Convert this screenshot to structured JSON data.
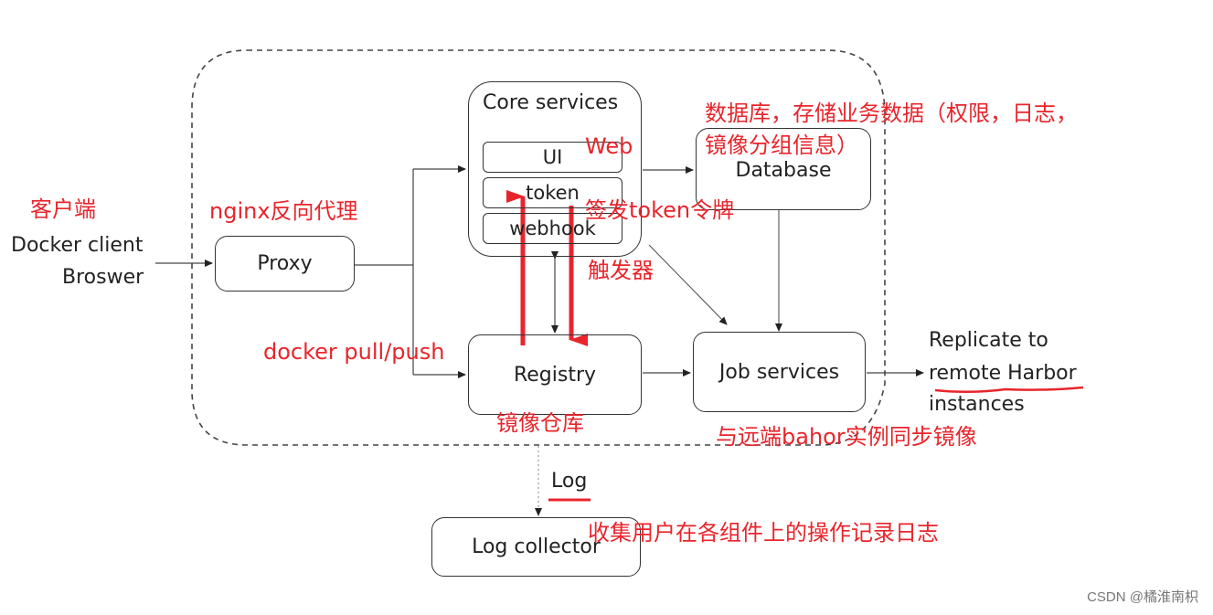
{
  "nodes": {
    "proxy": "Proxy",
    "core_services": "Core services",
    "ui": "UI",
    "token": "token",
    "webhook": "webhook",
    "database": "Database",
    "registry": "Registry",
    "job_services": "Job services",
    "log_collector": "Log collector"
  },
  "labels": {
    "client_line1": "Docker client",
    "client_line2": "Broswer",
    "replicate_line1": "Replicate to",
    "replicate_line2": "remote Harbor",
    "replicate_line3": "instances",
    "log": "Log"
  },
  "annotations": {
    "client": "客户端",
    "proxy": "nginx反向代理",
    "web": "Web",
    "token": "签发token令牌",
    "webhook": "触发器",
    "database_line1": "数据库，存储业务数据（权限，日志，",
    "database_line2": "镜像分组信息）",
    "docker_pull_push": "docker pull/push",
    "registry": "镜像仓库",
    "job_services": "与远端bahor实例同步镜像",
    "log_collector": "收集用户在各组件上的操作记录日志"
  },
  "colors": {
    "annotation": "#e8252c",
    "line": "#333333"
  },
  "watermark": "CSDN @橘淮南枳"
}
